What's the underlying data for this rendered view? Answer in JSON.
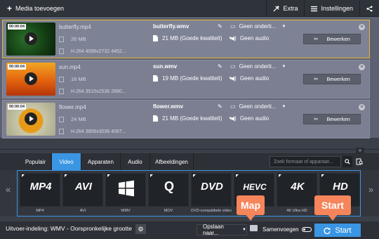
{
  "toolbar": {
    "add_media": "Media toevoegen",
    "extra": "Extra",
    "settings": "Instellingen"
  },
  "files": [
    {
      "duration": "00:00:04",
      "source_name": "butterfly.mp4",
      "source_size": "26 MB",
      "source_codec": "H.264 4096x2732 4452...",
      "output_name": "butterfly.wmv",
      "output_size": "21 MB (Goede kwaliteit)",
      "subtitles": "Geen onderti...",
      "audio": "Geen audio",
      "edit_label": "Bewerken",
      "selected": true
    },
    {
      "duration": "00:00:04",
      "source_name": "sun.mp4",
      "source_size": "16 MB",
      "source_codec": "H.264 3510x2536 2680...",
      "output_name": "sun.wmv",
      "output_size": "19 MB (Goede kwaliteit)",
      "subtitles": "Geen onderti...",
      "audio": "Geen audio",
      "edit_label": "Bewerken",
      "selected": false
    },
    {
      "duration": "00:00:04",
      "source_name": "flower.mp4",
      "source_size": "24 MB",
      "source_codec": "H.264 3806x3036 4067...",
      "output_name": "flower.wmv",
      "output_size": "21 MB (Goede kwaliteit)",
      "subtitles": "Geen onderti...",
      "audio": "Geen audio",
      "edit_label": "Bewerken",
      "selected": false
    }
  ],
  "tabs": [
    "Populair",
    "Video",
    "Apparaten",
    "Audio",
    "Afbeeldingen"
  ],
  "active_tab": "Video",
  "search_placeholder": "Zoek formaat of apparaat...",
  "formats": [
    {
      "icon_text": "MP4",
      "label": "MP4"
    },
    {
      "icon_text": "AVI",
      "label": "AVI"
    },
    {
      "icon_text": "",
      "label": "WMV",
      "icon": "windows-logo-icon"
    },
    {
      "icon_text": "Q",
      "label": "MOV"
    },
    {
      "icon_text": "DVD",
      "label": "DVD-compatibele video"
    },
    {
      "icon_text": "HEVC",
      "label": "HEVC"
    },
    {
      "icon_text": "4K",
      "label": "4K Ultra HD"
    },
    {
      "icon_text": "HD",
      "label": "HD"
    }
  ],
  "bottom": {
    "output_format": "Uitvoer-indeling: WMV - Oorspronkelijke grootte",
    "save_in": "Opslaan naar...",
    "merge": "Samenvoegen",
    "start": "Start"
  },
  "callouts": {
    "folder": "Map",
    "start": "Start"
  },
  "colors": {
    "accent": "#3a95e3",
    "selection": "#e3b833",
    "callout": "#f6855b"
  }
}
